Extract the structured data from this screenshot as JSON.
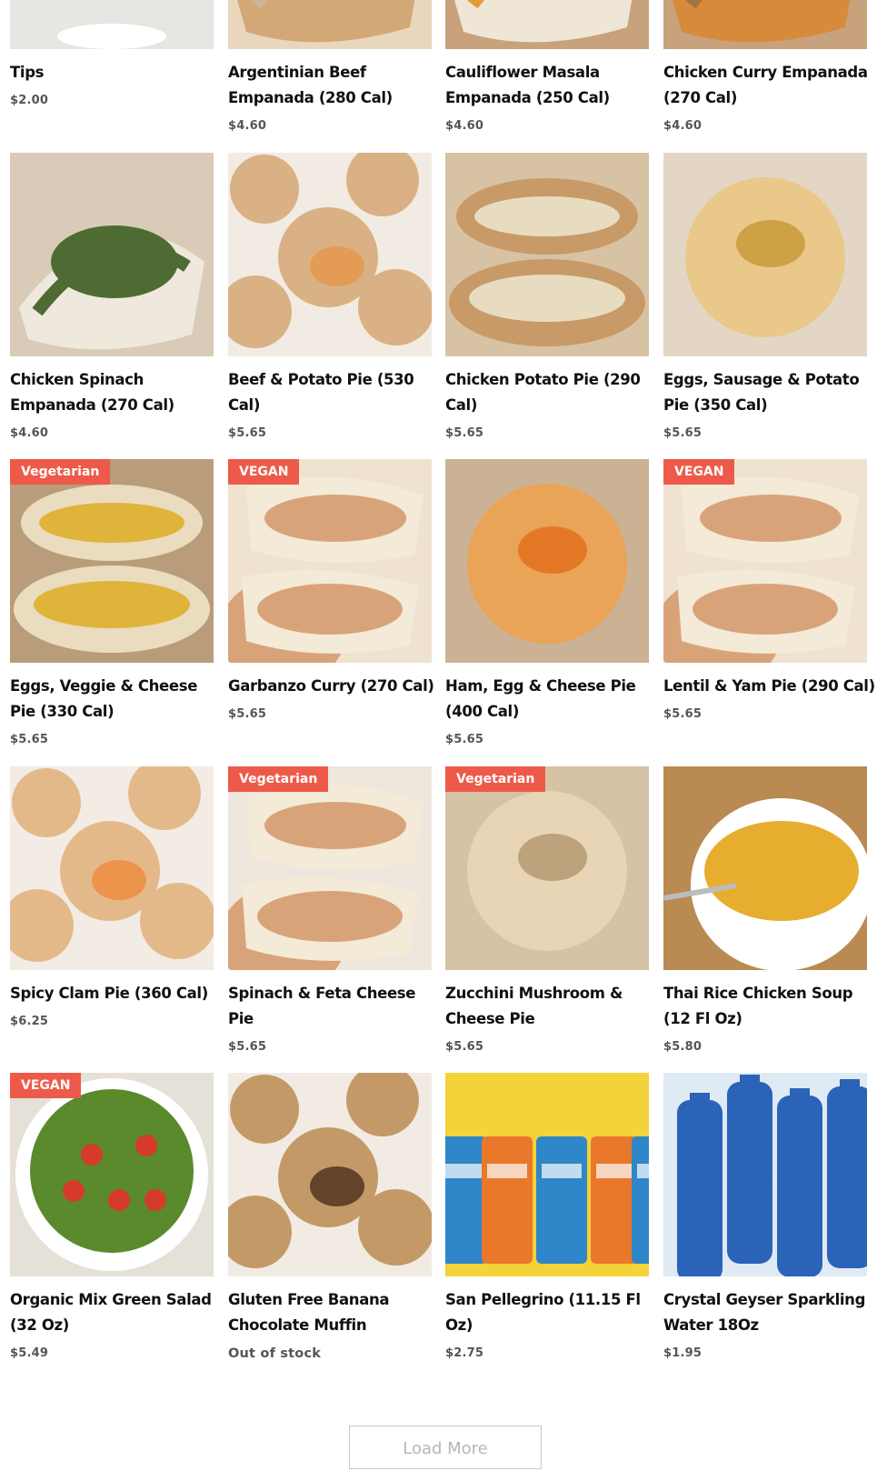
{
  "products": [
    {
      "name": "Tips",
      "price": "$2.00",
      "badge": "",
      "image": "tip-jar-photo",
      "colors": [
        "#f2f2f0",
        "#e6e6e3",
        "#ffffff"
      ]
    },
    {
      "name": "Argentinian Beef Empanada (280 Cal)",
      "price": "$4.60",
      "badge": "",
      "image": "empanada-photo",
      "colors": [
        "#e9d7bd",
        "#d2a876",
        "#c9b59a"
      ]
    },
    {
      "name": "Cauliflower Masala Empanada (250 Cal)",
      "price": "$4.60",
      "badge": "",
      "image": "empanada-photo",
      "colors": [
        "#c7a27c",
        "#f0e6d6",
        "#e39a3a"
      ]
    },
    {
      "name": "Chicken Curry Empanada (270 Cal)",
      "price": "$4.60",
      "badge": "",
      "image": "empanada-photo",
      "colors": [
        "#c7a27c",
        "#d78a3c",
        "#a0743e"
      ]
    },
    {
      "name": "Chicken Spinach Empanada (270 Cal)",
      "price": "$4.60",
      "badge": "",
      "image": "spinach-empanada-photo",
      "colors": [
        "#d9cbb8",
        "#efe8dc",
        "#4e6b34"
      ]
    },
    {
      "name": "Beef & Potato Pie (530 Cal)",
      "price": "$5.65",
      "badge": "",
      "image": "baked-pies-photo",
      "colors": [
        "#f1ebe3",
        "#d9b184",
        "#e6964a"
      ]
    },
    {
      "name": "Chicken Potato Pie (290 Cal)",
      "price": "$5.65",
      "badge": "",
      "image": "cut-pie-photo",
      "colors": [
        "#d8c2a4",
        "#c79a68",
        "#e8dcc0"
      ]
    },
    {
      "name": "Eggs, Sausage & Potato Pie (350 Cal)",
      "price": "$5.65",
      "badge": "",
      "image": "round-pie-photo",
      "colors": [
        "#e4d6c4",
        "#e9c889",
        "#c99a3c"
      ]
    },
    {
      "name": "Eggs, Veggie & Cheese Pie (330 Cal)",
      "price": "$5.65",
      "badge": "Vegetarian",
      "image": "cut-pie-photo",
      "colors": [
        "#b99c7a",
        "#eadcbf",
        "#e0b43a"
      ]
    },
    {
      "name": "Garbanzo Curry (270 Cal)",
      "price": "$5.65",
      "badge": "VEGAN",
      "image": "curry-pie-photo",
      "colors": [
        "#efe3d0",
        "#c9933c",
        "#d9a37a"
      ]
    },
    {
      "name": "Ham, Egg & Cheese Pie (400 Cal)",
      "price": "$5.65",
      "badge": "",
      "image": "round-pie-photo",
      "colors": [
        "#ccb294",
        "#e9a457",
        "#e4711f"
      ]
    },
    {
      "name": "Lentil & Yam Pie (290 Cal)",
      "price": "$5.65",
      "badge": "VEGAN",
      "image": "lentil-pie-photo",
      "colors": [
        "#efe3d0",
        "#8f7a4e",
        "#d9a37a"
      ]
    },
    {
      "name": "Spicy Clam Pie (360 Cal)",
      "price": "$6.25",
      "badge": "",
      "image": "baked-pies-photo",
      "colors": [
        "#f2ece4",
        "#e4b98a",
        "#ee8a3c"
      ]
    },
    {
      "name": "Spinach & Feta Cheese Pie",
      "price": "$5.65",
      "badge": "Vegetarian",
      "image": "spinach-pie-photo",
      "colors": [
        "#eee7dd",
        "#3c6e2a",
        "#d9a37a"
      ]
    },
    {
      "name": "Zucchini Mushroom & Cheese Pie",
      "price": "$5.65",
      "badge": "Vegetarian",
      "image": "round-pie-photo",
      "colors": [
        "#d6c3a6",
        "#e8d5b5",
        "#b59a72"
      ]
    },
    {
      "name": "Thai Rice Chicken Soup (12 Fl Oz)",
      "price": "$5.80",
      "badge": "",
      "image": "soup-bowl-photo",
      "colors": [
        "#b98a52",
        "#ffffff",
        "#e7ad2f"
      ]
    },
    {
      "name": "Organic Mix Green Salad (32 Oz)",
      "price": "$5.49",
      "badge": "VEGAN",
      "image": "salad-bowl-photo",
      "colors": [
        "#e6e1d8",
        "#5a8a2c",
        "#d63a2a"
      ]
    },
    {
      "name": "Gluten Free Banana Chocolate Muffin",
      "price": "Out of stock",
      "badge": "",
      "image": "muffins-photo",
      "colors": [
        "#f1ebe3",
        "#c39a67",
        "#4a2e1c"
      ]
    },
    {
      "name": "San Pellegrino (11.15 Fl Oz)",
      "price": "$2.75",
      "badge": "",
      "image": "soda-cans-photo",
      "colors": [
        "#5a5a58",
        "#f3d23a",
        "#e9782a"
      ]
    },
    {
      "name": "Crystal Geyser Sparkling Water 18Oz",
      "price": "$1.95",
      "badge": "",
      "image": "water-bottles-photo",
      "colors": [
        "#8a7a68",
        "#dfeaf4",
        "#2a63b8"
      ]
    }
  ],
  "load_more": {
    "label": "Load More"
  }
}
